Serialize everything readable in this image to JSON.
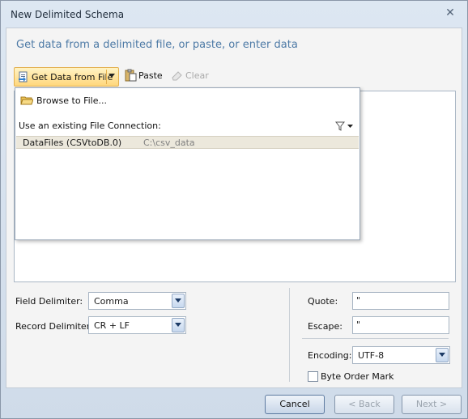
{
  "window": {
    "title": "New Delimited Schema",
    "close_glyph": "✕"
  },
  "heading": "Get data from a delimited file, or paste, or enter data",
  "toolbar": {
    "get_data_label": "Get Data from File",
    "paste_label": "Paste",
    "clear_label": "Clear"
  },
  "dropdown": {
    "browse_label": "Browse to File...",
    "existing_label": "Use an existing File Connection:",
    "connections": [
      {
        "name": "DataFiles (CSVtoDB.0)",
        "path": "C:\\csv_data"
      }
    ]
  },
  "fields": {
    "field_delimiter_label": "Field Delimiter:",
    "field_delimiter_value": "Comma",
    "record_delimiter_label": "Record Delimiter:",
    "record_delimiter_value": "CR + LF",
    "quote_label": "Quote:",
    "quote_value": "\"",
    "escape_label": "Escape:",
    "escape_value": "\"",
    "encoding_label": "Encoding:",
    "encoding_value": "UTF-8",
    "bom_label": "Byte Order Mark"
  },
  "buttons": {
    "cancel": "Cancel",
    "back": "< Back",
    "next": "Next >"
  }
}
